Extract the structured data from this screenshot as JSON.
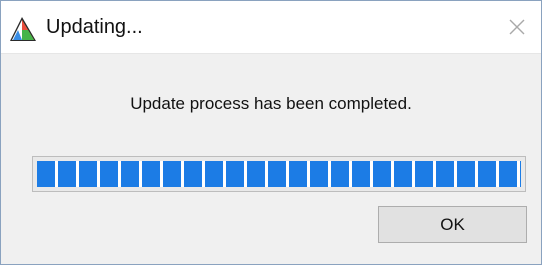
{
  "window": {
    "title": "Updating...",
    "icon": "app-icon",
    "close_icon": "close-icon"
  },
  "dialog": {
    "message": "Update process has been completed.",
    "progress_fraction": 1.0,
    "ok_label": "OK"
  },
  "colors": {
    "progress_fill": "#1c7ce5",
    "window_bg": "#f0f0f0"
  }
}
